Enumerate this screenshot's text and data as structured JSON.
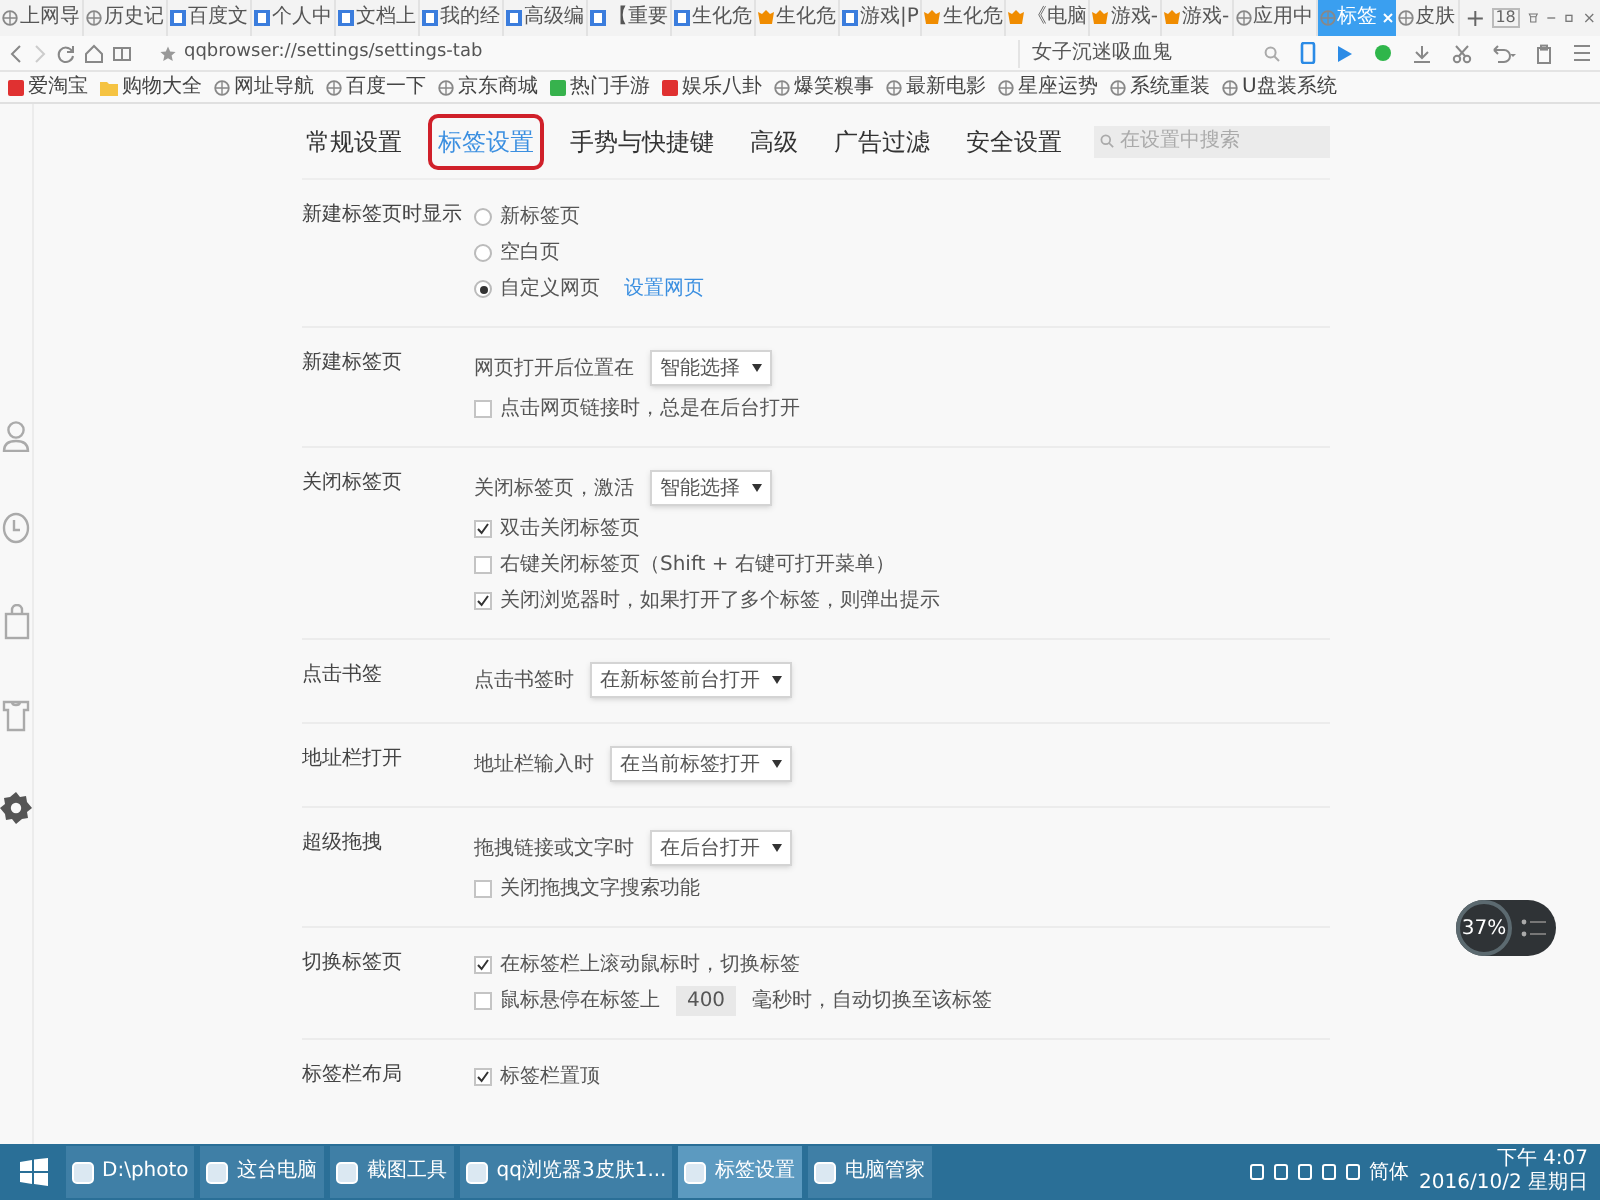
{
  "browser_tabs": [
    {
      "label": "上网导",
      "kind": "globe",
      "selected": false
    },
    {
      "label": "历史记",
      "kind": "globe",
      "selected": false
    },
    {
      "label": "百度文",
      "kind": "doc",
      "selected": false
    },
    {
      "label": "个人中",
      "kind": "doc",
      "selected": false
    },
    {
      "label": "文档上",
      "kind": "doc",
      "selected": false
    },
    {
      "label": "我的经",
      "kind": "doc",
      "selected": false
    },
    {
      "label": "高级编",
      "kind": "doc",
      "selected": false
    },
    {
      "label": "【重要",
      "kind": "doc",
      "selected": false
    },
    {
      "label": "生化危",
      "kind": "doc",
      "selected": false
    },
    {
      "label": "生化危",
      "kind": "game",
      "selected": false
    },
    {
      "label": "游戏|P",
      "kind": "doc",
      "selected": false
    },
    {
      "label": "生化危",
      "kind": "game",
      "selected": false
    },
    {
      "label": "《电脑",
      "kind": "game",
      "selected": false
    },
    {
      "label": "游戏-",
      "kind": "game",
      "selected": false
    },
    {
      "label": "游戏-",
      "kind": "game",
      "selected": false
    },
    {
      "label": "应用中",
      "kind": "globe",
      "selected": false
    },
    {
      "label": "标签",
      "kind": "globe",
      "selected": true
    },
    {
      "label": "皮肤",
      "kind": "globe",
      "selected": false
    }
  ],
  "new_tab": "+",
  "tab_count": "18",
  "address_bar": {
    "url": "qqbrowser://settings/settings-tab",
    "search_placeholder": "女子沉迷吸血鬼"
  },
  "bookmarks": [
    {
      "label": "爱淘宝",
      "kind": "badge",
      "color": "#e03131"
    },
    {
      "label": "购物大全",
      "kind": "folder"
    },
    {
      "label": "网址导航",
      "kind": "globe"
    },
    {
      "label": "百度一下",
      "kind": "globe"
    },
    {
      "label": "京东商城",
      "kind": "globe"
    },
    {
      "label": "热门手游",
      "kind": "badge",
      "color": "#37b24d"
    },
    {
      "label": "娱乐八卦",
      "kind": "badge",
      "color": "#e03131"
    },
    {
      "label": "爆笑糗事",
      "kind": "globe"
    },
    {
      "label": "最新电影",
      "kind": "globe"
    },
    {
      "label": "星座运势",
      "kind": "globe"
    },
    {
      "label": "系统重装",
      "kind": "globe"
    },
    {
      "label": "U盘装系统",
      "kind": "globe"
    }
  ],
  "settings_nav": [
    {
      "label": "常规设置",
      "selected": false
    },
    {
      "label": "标签设置",
      "selected": true
    },
    {
      "label": "手势与快捷键",
      "selected": false
    },
    {
      "label": "高级",
      "selected": false
    },
    {
      "label": "广告过滤",
      "selected": false
    },
    {
      "label": "安全设置",
      "selected": false
    }
  ],
  "settings_search": {
    "placeholder": "在设置中搜索"
  },
  "sections": [
    {
      "label": "新建标签页时显示",
      "rows": [
        {
          "kind": "radio",
          "label": "新标签页",
          "selected": false
        },
        {
          "kind": "radio",
          "label": "空白页",
          "selected": false
        },
        {
          "kind": "radio",
          "label": "自定义网页",
          "selected": true,
          "link": "设置网页"
        }
      ]
    },
    {
      "label": "新建标签页",
      "rows": [
        {
          "kind": "select",
          "label": "网页打开后位置在",
          "value": "智能选择"
        },
        {
          "kind": "checkbox",
          "label": "点击网页链接时，总是在后台打开",
          "checked": false
        }
      ]
    },
    {
      "label": "关闭标签页",
      "rows": [
        {
          "kind": "select",
          "label": "关闭标签页，激活",
          "value": "智能选择"
        },
        {
          "kind": "checkbox",
          "label": "双击关闭标签页",
          "checked": true
        },
        {
          "kind": "checkbox",
          "label": "右键关闭标签页（Shift + 右键可打开菜单）",
          "checked": false
        },
        {
          "kind": "checkbox",
          "label": "关闭浏览器时，如果打开了多个标签，则弹出提示",
          "checked": true
        }
      ]
    },
    {
      "label": "点击书签",
      "rows": [
        {
          "kind": "select",
          "label": "点击书签时",
          "value": "在新标签前台打开"
        }
      ]
    },
    {
      "label": "地址栏打开",
      "rows": [
        {
          "kind": "select",
          "label": "地址栏输入时",
          "value": "在当前标签打开"
        }
      ]
    },
    {
      "label": "超级拖拽",
      "rows": [
        {
          "kind": "select",
          "label": "拖拽链接或文字时",
          "value": "在后台打开"
        },
        {
          "kind": "checkbox",
          "label": "关闭拖拽文字搜索功能",
          "checked": false
        }
      ]
    },
    {
      "label": "切换标签页",
      "rows": [
        {
          "kind": "checkbox",
          "label": "在标签栏上滚动鼠标时，切换标签",
          "checked": true
        },
        {
          "kind": "checkbox_input",
          "label": "鼠标悬停在标签上",
          "value": "400",
          "suffix": "毫秒时，自动切换至该标签",
          "checked": false
        }
      ]
    },
    {
      "label": "标签栏布局",
      "rows": [
        {
          "kind": "checkbox",
          "label": "标签栏置顶",
          "checked": true
        }
      ]
    }
  ],
  "speed_ball": {
    "reading": "37%"
  },
  "taskbar": {
    "items": [
      {
        "label": "D:\\photo",
        "selected": false
      },
      {
        "label": "这台电脑",
        "selected": false
      },
      {
        "label": "截图工具",
        "selected": false
      },
      {
        "label": "qq浏览器3皮肤1...",
        "selected": false
      },
      {
        "label": "标签设置",
        "selected": true
      },
      {
        "label": "电脑管家",
        "selected": false
      }
    ],
    "language": "简体",
    "time": "下午 4:07",
    "date": "2016/10/2 星期日"
  }
}
